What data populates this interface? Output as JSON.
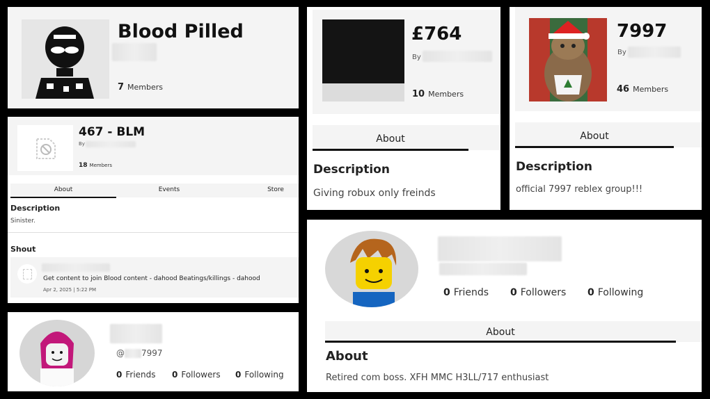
{
  "card_blood_pilled": {
    "title": "Blood Pilled",
    "member_count": "7",
    "members_label": "Members"
  },
  "card_764": {
    "title": "£764",
    "by_label": "By",
    "member_count": "10",
    "members_label": "Members",
    "tab": "About",
    "description_heading": "Description",
    "description_text": "Giving robux only freinds"
  },
  "card_7997": {
    "title": "7997",
    "by_label": "By",
    "member_count": "46",
    "members_label": "Members",
    "tab": "About",
    "description_heading": "Description",
    "description_text": "official 7997 reblex group!!!"
  },
  "card_blm": {
    "title": "467 - BLM",
    "by_label": "By",
    "member_count": "18",
    "members_label": "Members",
    "tabs": [
      "About",
      "Events",
      "Store"
    ],
    "description_heading": "Description",
    "description_text": "Sinister.",
    "shout_heading": "Shout",
    "shout_text": "Get content to join Blood content - dahood Beatings/killings - dahood",
    "shout_date": "Apr 2, 2025 | 5:22 PM"
  },
  "profile_small": {
    "handle_prefix": "@",
    "handle_suffix": "7997",
    "friends_count": "0",
    "friends_label": "Friends",
    "followers_count": "0",
    "followers_label": "Followers",
    "following_count": "0",
    "following_label": "Following"
  },
  "profile_large": {
    "friends_count": "0",
    "friends_label": "Friends",
    "followers_count": "0",
    "followers_label": "Followers",
    "following_count": "0",
    "following_label": "Following",
    "tab": "About",
    "about_heading": "About",
    "about_text": "Retired com boss. XFH MMC H3LL/717 enthusiast"
  }
}
